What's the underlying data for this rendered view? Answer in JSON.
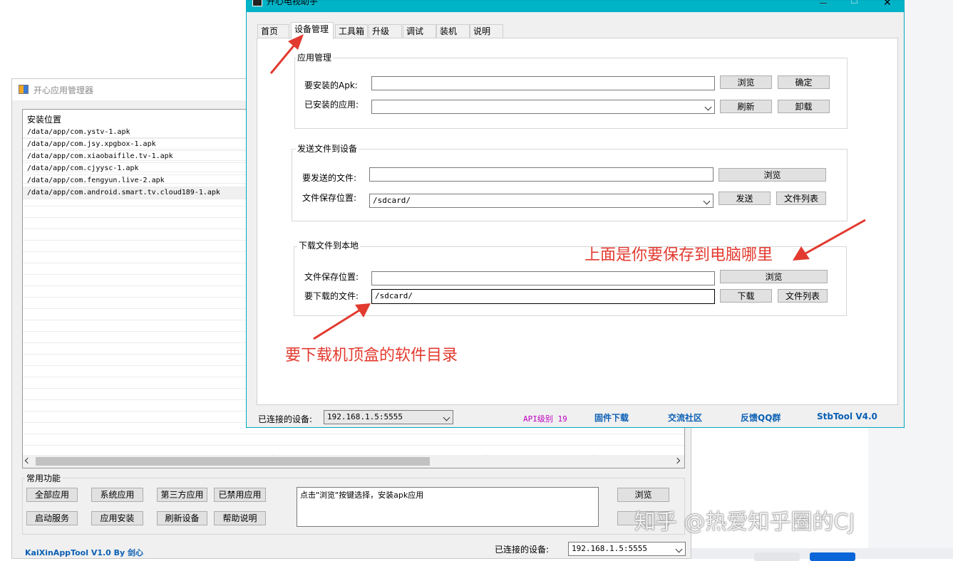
{
  "back_window": {
    "title": "开心应用管理器",
    "list_header": "安装位置",
    "list_items": [
      "/data/app/com.ystv-1.apk",
      "/data/app/com.jsy.xpgbox-1.apk",
      "/data/app/com.xiaobaifile.tv-1.apk",
      "/data/app/com.cjyysc-1.apk",
      "/data/app/com.fengyun.live-2.apk",
      "/data/app/com.android.smart.tv.cloud189-1.apk"
    ],
    "common_group": "常用功能",
    "buttons_row1": [
      "全部应用",
      "系统应用",
      "第三方应用",
      "已禁用应用"
    ],
    "buttons_row2": [
      "启动服务",
      "应用安装",
      "刷新设备",
      "帮助说明"
    ],
    "hint_text": "点击\"浏览\"按键选择，安装apk应用",
    "browse_button": "浏览",
    "footer_brand": "KaiXinAppTool V1.0 By 剑心",
    "connected_label": "已连接的设备:",
    "connected_device": "192.168.1.5:5555"
  },
  "front_window": {
    "title": "开心电视助手",
    "tabs": [
      "首页",
      "设备管理",
      "工具箱",
      "升级",
      "调试",
      "装机",
      "说明"
    ],
    "active_tab": 1,
    "app_group": {
      "legend": "应用管理",
      "apk_label": "要安装的Apk:",
      "installed_label": "已安装的应用:",
      "browse": "浏览",
      "confirm": "确定",
      "refresh": "刷新",
      "uninstall": "卸载"
    },
    "send_group": {
      "legend": "发送文件到设备",
      "file_label": "要发送的文件:",
      "save_label": "文件保存位置:",
      "save_value": "/sdcard/",
      "browse": "浏览",
      "send": "发送",
      "file_list": "文件列表"
    },
    "download_group": {
      "legend": "下载文件到本地",
      "save_label": "文件保存位置:",
      "file_label": "要下载的文件:",
      "file_value": "/sdcard/",
      "browse": "浏览",
      "download": "下载",
      "file_list": "文件列表"
    },
    "status": {
      "connected_label": "已连接的设备:",
      "connected_device": "192.168.1.5:5555",
      "api_level": "API级别 19",
      "firmware": "固件下载",
      "community": "交流社区",
      "feedback": "反馈QQ群",
      "version": "StbTool V4.0"
    }
  },
  "annotations": {
    "top_right": "上面是你要保存到电脑哪里",
    "bottom_left": "要下载机顶盒的软件目录"
  },
  "watermark": "知乎 @热爱知乎圈的CJ",
  "colors": {
    "titlebar": "#00b4c8",
    "annotation": "#e23a2f",
    "link": "#0a5fb4",
    "api": "#c000c0"
  }
}
